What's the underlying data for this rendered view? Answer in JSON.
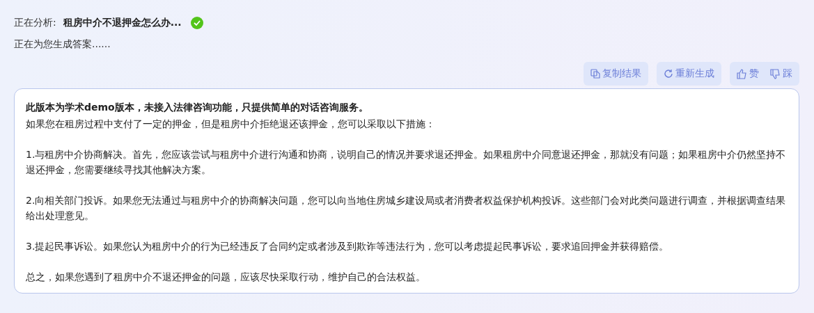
{
  "status": {
    "label": "正在分析:",
    "query": "租房中介不退押金怎么办...",
    "done": true
  },
  "progress": "正在为您生成答案......",
  "actions": [
    {
      "kind": "copy",
      "label": "复制结果"
    },
    {
      "kind": "regenerate",
      "label": "重新生成"
    }
  ],
  "feedback": [
    {
      "kind": "like",
      "label": "赞"
    },
    {
      "kind": "dislike",
      "label": "踩"
    }
  ],
  "answer": {
    "notice": "此版本为学术demo版本，未接入法律咨询功能，只提供简单的对话咨询服务。",
    "paragraphs": [
      "如果您在租房过程中支付了一定的押金，但是租房中介拒绝退还该押金，您可以采取以下措施：",
      "1.与租房中介协商解决。首先，您应该尝试与租房中介进行沟通和协商，说明自己的情况并要求退还押金。如果租房中介同意退还押金，那就没有问题；如果租房中介仍然坚持不退还押金，您需要继续寻找其他解决方案。",
      "2.向相关部门投诉。如果您无法通过与租房中介的协商解决问题，您可以向当地住房城乡建设局或者消费者权益保护机构投诉。这些部门会对此类问题进行调查，并根据调查结果给出处理意见。",
      "3.提起民事诉讼。如果您认为租房中介的行为已经违反了合同约定或者涉及到欺诈等违法行为，您可以考虑提起民事诉讼，要求追回押金并获得赔偿。",
      "总之，如果您遇到了租房中介不退还押金的问题，应该尽快采取行动，维护自己的合法权益。"
    ]
  }
}
